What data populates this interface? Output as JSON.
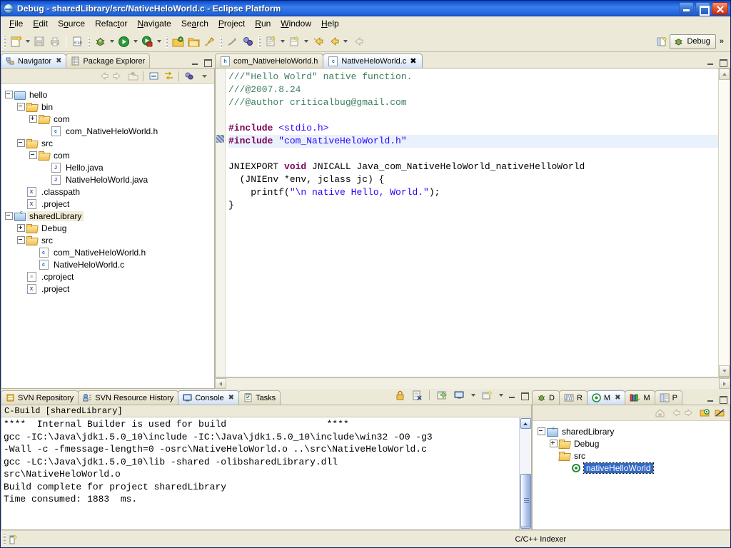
{
  "window": {
    "title": "Debug - sharedLibrary/src/NativeHeloWorld.c - Eclipse Platform",
    "icon": "eclipse-icon",
    "minimize_label": "Minimize",
    "maximize_label": "Maximize",
    "close_label": "Close"
  },
  "menubar": {
    "items": [
      {
        "label": "File"
      },
      {
        "label": "Edit"
      },
      {
        "label": "Source"
      },
      {
        "label": "Refactor"
      },
      {
        "label": "Navigate"
      },
      {
        "label": "Search"
      },
      {
        "label": "Project"
      },
      {
        "label": "Run"
      },
      {
        "label": "Window"
      },
      {
        "label": "Help"
      }
    ]
  },
  "toolbar": {
    "perspective_label": "Debug",
    "perspective_chevron": "»",
    "icons": [
      "new-wizard-icon",
      "save-icon",
      "print-icon",
      "build-binary-icon",
      "debug-icon",
      "run-icon",
      "run-external-tools-icon",
      "open-type-icon",
      "open-resource-icon",
      "search-icon",
      "skip-breakpoints-icon",
      "profile-icon",
      "new-java-class-icon",
      "new-java-package-icon",
      "next-annotation-icon",
      "previous-annotation-icon",
      "back-icon",
      "open-perspective-icon"
    ]
  },
  "navigator": {
    "tabs": [
      {
        "label": "Navigator",
        "icon": "navigator-icon",
        "active": true,
        "closable": true
      },
      {
        "label": "Package Explorer",
        "icon": "package-explorer-icon",
        "active": false,
        "closable": false
      }
    ],
    "toolbar_icons": [
      "back-icon",
      "forward-icon",
      "up-icon",
      "collapse-all-icon",
      "link-with-editor-icon",
      "filters-icon",
      "view-menu-icon"
    ],
    "tree": [
      {
        "label": "hello",
        "indent": 0,
        "expander": "minus",
        "icon": "project-icon",
        "selected": false
      },
      {
        "label": "bin",
        "indent": 1,
        "expander": "minus",
        "icon": "folder-icon",
        "selected": false
      },
      {
        "label": "com",
        "indent": 2,
        "expander": "plus",
        "icon": "folder-icon",
        "selected": false
      },
      {
        "label": "com_NativeHeloWorld.h",
        "indent": 3,
        "expander": "none",
        "icon": "c-header-icon",
        "selected": false
      },
      {
        "label": "src",
        "indent": 1,
        "expander": "minus",
        "icon": "folder-icon",
        "selected": false
      },
      {
        "label": "com",
        "indent": 2,
        "expander": "minus",
        "icon": "folder-icon",
        "selected": false
      },
      {
        "label": "Hello.java",
        "indent": 3,
        "expander": "none",
        "icon": "java-file-icon",
        "selected": false
      },
      {
        "label": "NativeHeloWorld.java",
        "indent": 3,
        "expander": "none",
        "icon": "java-file-icon",
        "selected": false
      },
      {
        "label": ".classpath",
        "indent": 1,
        "expander": "none",
        "icon": "xml-file-icon",
        "selected": false
      },
      {
        "label": ".project",
        "indent": 1,
        "expander": "none",
        "icon": "xml-file-icon",
        "selected": false
      },
      {
        "label": "sharedLibrary",
        "indent": 0,
        "expander": "minus",
        "icon": "c-project-icon",
        "selected": true
      },
      {
        "label": "Debug",
        "indent": 1,
        "expander": "plus",
        "icon": "folder-icon",
        "selected": false
      },
      {
        "label": "src",
        "indent": 1,
        "expander": "minus",
        "icon": "folder-icon",
        "selected": false
      },
      {
        "label": "com_NativeHeloWorld.h",
        "indent": 2,
        "expander": "none",
        "icon": "c-header-icon",
        "selected": false
      },
      {
        "label": "NativeHeloWorld.c",
        "indent": 2,
        "expander": "none",
        "icon": "c-source-icon",
        "selected": false
      },
      {
        "label": ".cproject",
        "indent": 1,
        "expander": "none",
        "icon": "plain-file-icon",
        "selected": false
      },
      {
        "label": ".project",
        "indent": 1,
        "expander": "none",
        "icon": "xml-file-icon",
        "selected": false
      }
    ]
  },
  "editor": {
    "tabs": [
      {
        "label": "com_NativeHeloWorld.h",
        "icon": "h-file-icon",
        "active": false,
        "closable": false
      },
      {
        "label": "NativeHeloWorld.c",
        "icon": "c-file-icon",
        "active": true,
        "closable": true
      }
    ],
    "code_lines": [
      {
        "segments": [
          {
            "t": "///\"Hello Wolrd\" native function.",
            "c": "cmt"
          }
        ]
      },
      {
        "segments": [
          {
            "t": "///@2007.8.24",
            "c": "cmt"
          }
        ]
      },
      {
        "segments": [
          {
            "t": "///@author criticalbug@gmail.com",
            "c": "cmt"
          }
        ]
      },
      {
        "segments": [
          {
            "t": "",
            "c": ""
          }
        ]
      },
      {
        "segments": [
          {
            "t": "#include ",
            "c": "pp"
          },
          {
            "t": "<stdio.h>",
            "c": "str"
          }
        ]
      },
      {
        "highlight": true,
        "segments": [
          {
            "t": "#include ",
            "c": "pp"
          },
          {
            "t": "\"com_NativeHeloWorld.h\"",
            "c": "str"
          }
        ]
      },
      {
        "segments": [
          {
            "t": "",
            "c": ""
          }
        ]
      },
      {
        "segments": [
          {
            "t": "JNIEXPORT ",
            "c": ""
          },
          {
            "t": "void",
            "c": "kw"
          },
          {
            "t": " JNICALL Java_com_NativeHeloWorld_nativeHelloWorld",
            "c": ""
          }
        ]
      },
      {
        "segments": [
          {
            "t": "  (JNIEnv *env, jclass jc) {",
            "c": ""
          }
        ]
      },
      {
        "segments": [
          {
            "t": "    printf(",
            "c": ""
          },
          {
            "t": "\"\\n native Hello, World.\"",
            "c": "str"
          },
          {
            "t": ");",
            "c": ""
          }
        ]
      },
      {
        "segments": [
          {
            "t": "}",
            "c": ""
          }
        ]
      }
    ]
  },
  "console": {
    "tabs": [
      {
        "label": "SVN Repository",
        "icon": "svn-repository-icon",
        "active": false,
        "closable": false
      },
      {
        "label": "SVN Resource History",
        "icon": "svn-resource-history-icon",
        "active": false,
        "closable": false
      },
      {
        "label": "Console",
        "icon": "console-icon",
        "active": true,
        "closable": true
      },
      {
        "label": "Tasks",
        "icon": "tasks-icon",
        "active": false,
        "closable": false
      }
    ],
    "toolbar_icons": [
      "lock-icon",
      "clear-console-icon",
      "pin-console-icon",
      "display-selected-console-icon",
      "new-console-view-icon"
    ],
    "header": "C-Build [sharedLibrary]",
    "output": [
      "****  Internal Builder is used for build                  ****",
      "gcc -IC:\\Java\\jdk1.5.0_10\\include -IC:\\Java\\jdk1.5.0_10\\include\\win32 -O0 -g3",
      "-Wall -c -fmessage-length=0 -osrc\\NativeHeloWorld.o ..\\src\\NativeHeloWorld.c",
      "gcc -LC:\\Java\\jdk1.5.0_10\\lib -shared -olibsharedLibrary.dll",
      "src\\NativeHeloWorld.o",
      "Build complete for project sharedLibrary",
      "Time consumed: 1883  ms."
    ]
  },
  "outline": {
    "tabs": [
      {
        "label": "D",
        "icon": "debug-view-icon",
        "active": false,
        "closable": false
      },
      {
        "label": "R",
        "icon": "registers-icon",
        "active": false,
        "closable": false
      },
      {
        "label": "M",
        "icon": "make-targets-icon",
        "active": true,
        "closable": true
      },
      {
        "label": "M",
        "icon": "modules-icon",
        "active": false,
        "closable": false
      },
      {
        "label": "P",
        "icon": "properties-icon",
        "active": false,
        "closable": false
      }
    ],
    "toolbar_icons": [
      "home-icon",
      "back-icon",
      "forward-icon",
      "build-target-icon",
      "hide-folders-icon"
    ],
    "tree": [
      {
        "label": "sharedLibrary",
        "indent": 0,
        "expander": "minus",
        "icon": "c-project-icon",
        "selected": false
      },
      {
        "label": "Debug",
        "indent": 1,
        "expander": "plus",
        "icon": "folder-icon",
        "selected": false
      },
      {
        "label": "src",
        "indent": 1,
        "expander": "none",
        "icon": "folder-icon",
        "selected": false
      },
      {
        "label": "nativeHelloWorld",
        "indent": 2,
        "expander": "none",
        "icon": "make-target-icon",
        "selected": true
      }
    ]
  },
  "statusbar": {
    "left_icon": "writable-indicator-icon",
    "text": "C/C++ Indexer"
  },
  "colors": {
    "title_blue": "#1d62dd",
    "chrome": "#ece9d8",
    "comment_green": "#3f7f5f",
    "keyword_purple": "#7f0055",
    "string_blue": "#2a00ff",
    "selection_blue": "#3169c6",
    "highlight_line": "#e8f1fc"
  }
}
